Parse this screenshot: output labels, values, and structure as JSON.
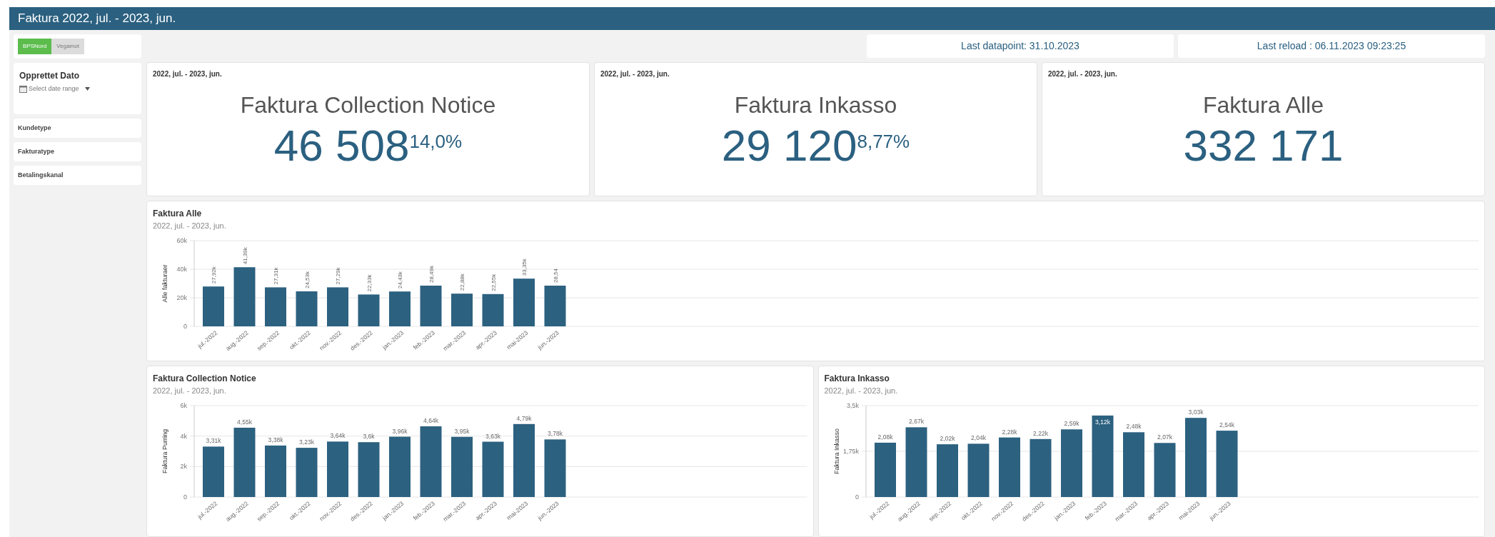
{
  "header": {
    "title": "Faktura 2022, jul. - 2023, jun."
  },
  "company_toggle": [
    {
      "label": "BPSNord",
      "selected": true
    },
    {
      "label": "Vegamot",
      "selected": false
    }
  ],
  "info": {
    "last_datapoint": "Last datapoint: 31.10.2023",
    "last_reload": "Last reload : 06.11.2023 09:23:25"
  },
  "filters": {
    "date": {
      "label": "Opprettet Dato",
      "placeholder": "Select date range"
    },
    "items": [
      "Kundetype",
      "Fakturatype",
      "Betalingskanal"
    ]
  },
  "kpis": [
    {
      "period": "2022, jul. - 2023, jun.",
      "title": "Faktura Collection Notice",
      "value": "46 508",
      "percent": "14,0%"
    },
    {
      "period": "2022, jul. - 2023, jun.",
      "title": "Faktura Inkasso",
      "value": "29 120",
      "percent": "8,77%"
    },
    {
      "period": "2022, jul. - 2023, jun.",
      "title": "Faktura Alle",
      "value": "332 171"
    }
  ],
  "charts": [
    {
      "title": "Faktura Alle",
      "subtitle": "2022, jul. - 2023, jun.",
      "chart_data": {
        "type": "bar",
        "categories": [
          "jul.-2022",
          "aug.-2022",
          "sep.-2022",
          "okt.-2022",
          "nov.-2022",
          "des.-2022",
          "jan.-2023",
          "feb.-2023",
          "mar.-2023",
          "apr.-2023",
          "mai-2023",
          "jun.-2023"
        ],
        "series": [
          {
            "name": "Alle fakturaer",
            "color": "#2c6180",
            "values": [
              27900,
              41400,
              27300,
              24500,
              27300,
              22300,
              24400,
              28500,
              22900,
              22600,
              33400,
              28500
            ]
          }
        ],
        "ylim": [
          0,
          60000
        ],
        "yticks": [
          {
            "value": 0,
            "label": "0"
          },
          {
            "value": 20000,
            "label": "20k"
          },
          {
            "value": 40000,
            "label": "40k"
          },
          {
            "value": 60000,
            "label": "60k"
          }
        ],
        "value_labels": [
          "27,92k",
          "41,39k",
          "27,31k",
          "24,53k",
          "27,29k",
          "22,33k",
          "24,43k",
          "28,49k",
          "22,88k",
          "22,55k",
          "33,35k",
          "28,54"
        ]
      }
    },
    {
      "title": "Faktura Collection Notice",
      "subtitle": "2022, jul. - 2023, jun.",
      "chart_data": {
        "type": "bar",
        "categories": [
          "jul.-2022",
          "aug.-2022",
          "sep.-2022",
          "okt.-2022",
          "nov.-2022",
          "des.-2022",
          "jan.-2023",
          "feb.-2023",
          "mar.-2023",
          "apr.-2023",
          "mai-2023",
          "jun.-2023"
        ],
        "series": [
          {
            "name": "Faktura Purring",
            "color": "#2c6180",
            "values": [
              3310,
              4550,
              3380,
              3230,
              3640,
              3600,
              3960,
              4640,
              3950,
              3630,
              4790,
              3780
            ]
          }
        ],
        "ylim": [
          0,
          6000
        ],
        "yticks": [
          {
            "value": 0,
            "label": "0"
          },
          {
            "value": 2000,
            "label": "2k"
          },
          {
            "value": 4000,
            "label": "4k"
          },
          {
            "value": 6000,
            "label": "6k"
          }
        ],
        "value_labels": [
          "3,31k",
          "4,55k",
          "3,38k",
          "3,23k",
          "3,64k",
          "3,6k",
          "3,96k",
          "4,64k",
          "3,95k",
          "3,63k",
          "4,79k",
          "3,78k"
        ]
      }
    },
    {
      "title": "Faktura Inkasso",
      "subtitle": "2022, jul. - 2023, jun.",
      "chart_data": {
        "type": "bar",
        "categories": [
          "jul.-2022",
          "aug.-2022",
          "sep.-2022",
          "okt.-2022",
          "nov.-2022",
          "des.-2022",
          "jan.-2023",
          "feb.-2023",
          "mar.-2023",
          "apr.-2023",
          "mai-2023",
          "jun.-2023"
        ],
        "series": [
          {
            "name": "Faktura Inkasso",
            "color": "#2c6180",
            "values": [
              2080,
              2670,
              2020,
              2040,
              2280,
              2220,
              2590,
              3120,
              2480,
              2070,
              3030,
              2540
            ]
          }
        ],
        "ylim": [
          0,
          3500
        ],
        "yticks": [
          {
            "value": 0,
            "label": "0"
          },
          {
            "value": 1750,
            "label": "1,75k"
          },
          {
            "value": 3500,
            "label": "3,5k"
          }
        ],
        "value_labels": [
          "2,08k",
          "2,67k",
          "2,02k",
          "2,04k",
          "2,28k",
          "2,22k",
          "2,59k",
          "3,12k",
          "2,48k",
          "2,07k",
          "3,03k",
          "2,54k"
        ]
      }
    }
  ]
}
